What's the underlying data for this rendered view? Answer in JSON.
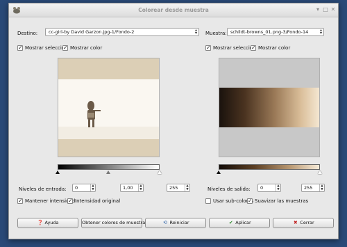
{
  "window": {
    "title": "Colorear desde muestra"
  },
  "left": {
    "label": "Destino:",
    "combo_value": "cc-girl-by David Garzon.jpg-1/Fondo-2",
    "check_selection": "Mostrar selección",
    "check_color": "Mostrar color",
    "levels_label": "Niveles de entrada:",
    "level_low": "0",
    "level_gamma": "1,00",
    "level_high": "255",
    "keep_intensity": "Mantener intensidad",
    "original_intensity": "Intensidad original"
  },
  "right": {
    "label": "Muestra:",
    "combo_value": "schildt-browns_01.png-3/Fondo-14",
    "check_selection": "Mostrar selección",
    "check_color": "Mostrar color",
    "levels_label": "Niveles de salida:",
    "level_low": "0",
    "level_high": "255",
    "use_subcolors": "Usar sub-colores",
    "smooth_samples": "Suavizar las muestras"
  },
  "buttons": {
    "help": "Ayuda",
    "get_colors": "Obtener colores de muestra",
    "reset": "Reiniciar",
    "apply": "Aplicar",
    "close": "Cerrar"
  }
}
